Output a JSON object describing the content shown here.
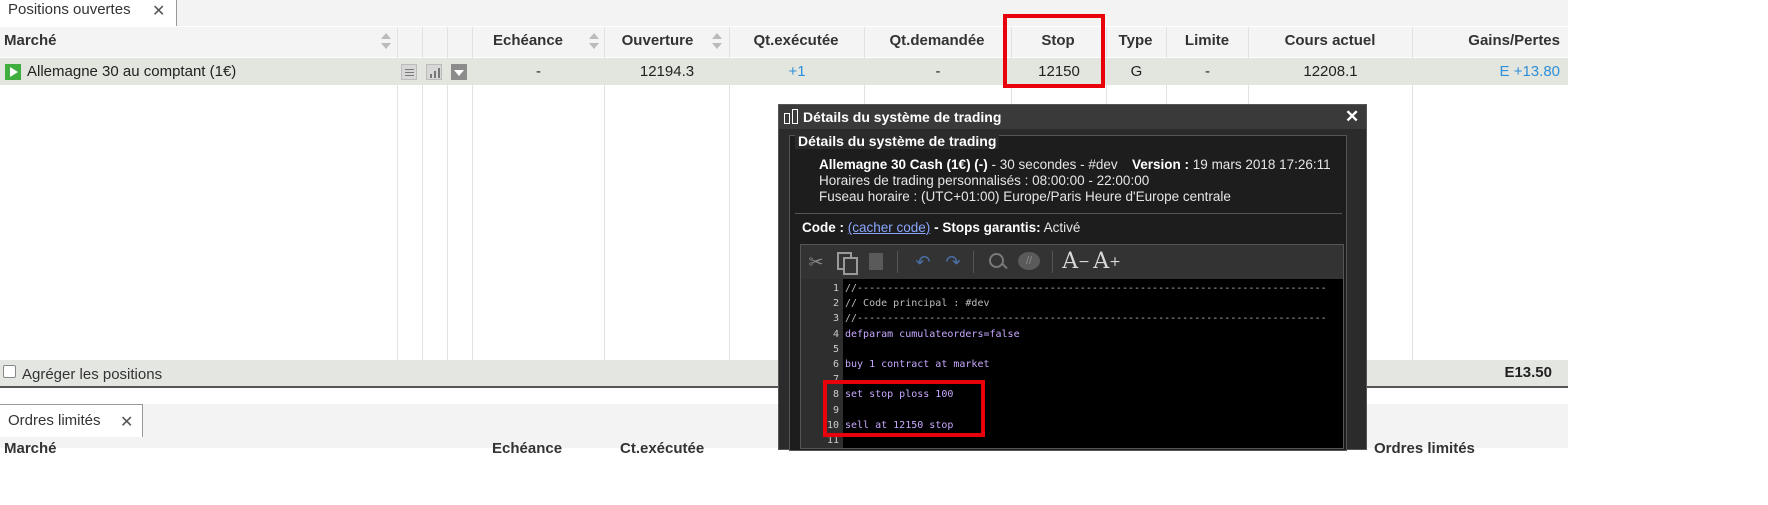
{
  "colors": {
    "highlight": "#e8000b",
    "link": "#2f8fd8",
    "play_icon": "#3fae3f"
  },
  "tabs": {
    "positions_label": "Positions ouvertes",
    "orders_label": "Ordres limités",
    "close_glyph": "✕"
  },
  "table": {
    "headers": {
      "marche": "Marché",
      "echeance": "Echéance",
      "ouverture": "Ouverture",
      "qt_executee": "Qt.exécutée",
      "qt_demandee": "Qt.demandée",
      "stop": "Stop",
      "type": "Type",
      "limite": "Limite",
      "cours_actuel": "Cours actuel",
      "gains_pertes": "Gains/Pertes"
    },
    "row": {
      "marche": "Allemagne 30 au comptant (1€)",
      "echeance": "-",
      "ouverture": "12194.3",
      "qt_executee": "+1",
      "qt_demandee": "-",
      "stop": "12150",
      "type": "G",
      "limite": "-",
      "cours_actuel": "12208.1",
      "gains_pertes": "E +13.80"
    },
    "footer": {
      "aggregate_label": "Agréger les positions",
      "total": "E13.50"
    },
    "partial_header": {
      "marche": "Marché",
      "echeance": "Echéance",
      "col3": "Ct.exécutée",
      "col_last": "Ordres limités"
    }
  },
  "popup": {
    "window_title": "Détails du système de trading",
    "legend": "Détails du système de trading",
    "system_name": "Allemagne 30 Cash (1€) (-)",
    "system_suffix": " - 30 secondes - #dev",
    "version_label": "Version :",
    "version_value": "19 mars 2018 17:26:11",
    "hours_line": "Horaires de trading personnalisés : 08:00:00 - 22:00:00",
    "timezone_line": "Fuseau horaire : (UTC+01:00) Europe/Paris Heure d'Europe centrale",
    "code_label": "Code :",
    "code_link": "(cacher code)",
    "stops_label": " - Stops garantis:",
    "stops_value": " Activé",
    "close_glyph": "✕",
    "toolbar": [
      "cut-icon",
      "copy-icon",
      "paste-icon",
      "undo-icon",
      "redo-icon",
      "search-icon",
      "comment-icon",
      "decrease-font-icon",
      "increase-font-icon"
    ],
    "code_lines": [
      {
        "n": "1",
        "text": "//------------------------------------------------------------------------------",
        "color": "#bdbdbd"
      },
      {
        "n": "2",
        "text": "// Code principal : #dev",
        "color": "#bdbdbd"
      },
      {
        "n": "3",
        "text": "//------------------------------------------------------------------------------",
        "color": "#bdbdbd"
      },
      {
        "n": "4",
        "text": "defparam cumulateorders=false",
        "color": "#c8a8ff"
      },
      {
        "n": "5",
        "text": "",
        "color": "#ccc"
      },
      {
        "n": "6",
        "text": "buy 1 contract at market",
        "color": "#c8a8ff"
      },
      {
        "n": "7",
        "text": "",
        "color": "#ccc"
      },
      {
        "n": "8",
        "text": "set stop ploss 100",
        "color": "#c8a8ff"
      },
      {
        "n": "9",
        "text": "",
        "color": "#ccc"
      },
      {
        "n": "10",
        "text": "sell at 12150 stop",
        "color": "#c8a8ff"
      },
      {
        "n": "11",
        "text": "",
        "color": "#ccc"
      }
    ]
  }
}
